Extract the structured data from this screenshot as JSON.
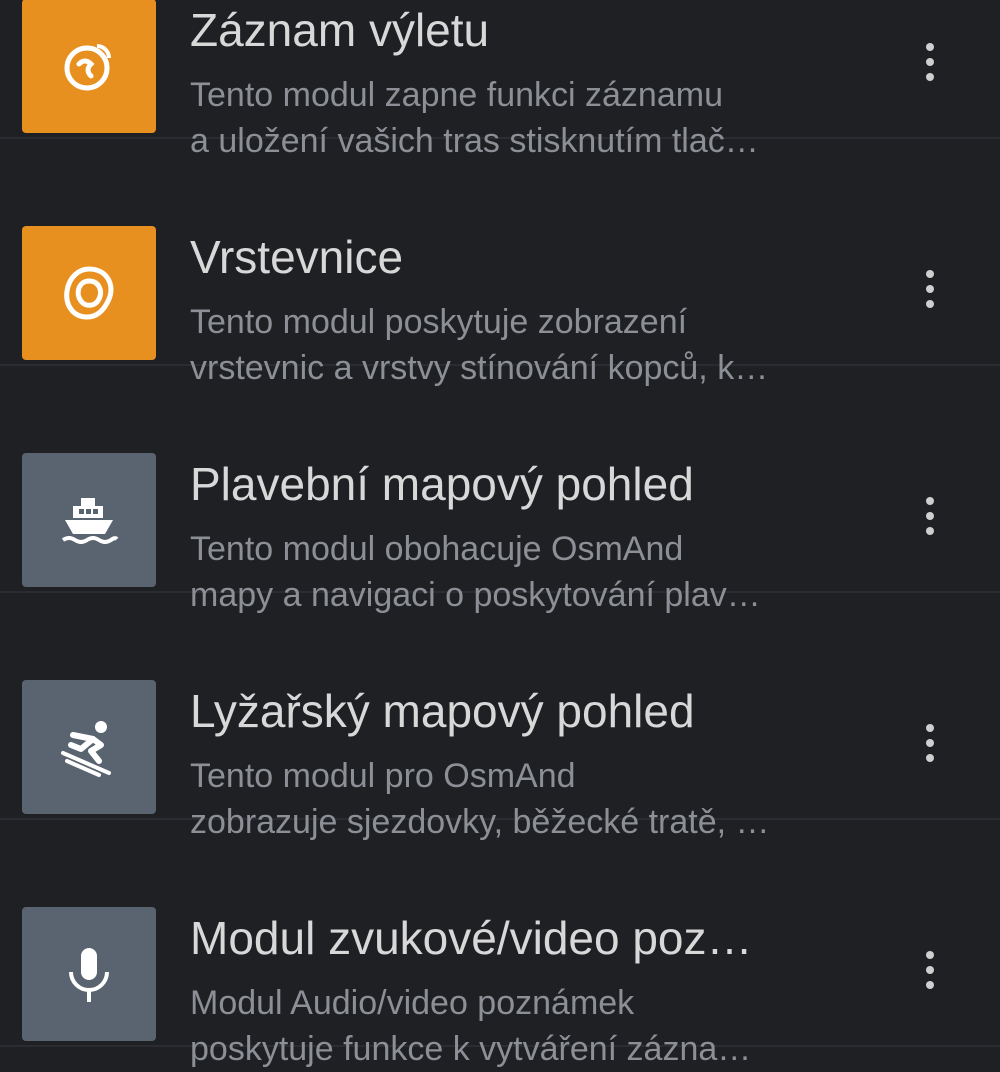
{
  "plugins": [
    {
      "title": "Záznam výletu",
      "desc_line1": "Tento modul zapne funkci záznamu",
      "desc_line2": "a uložení vašich tras stisknutím tlač…",
      "icon": "trip-recording-icon",
      "enabled": true
    },
    {
      "title": "Vrstevnice",
      "desc_line1": "Tento modul poskytuje zobrazení",
      "desc_line2": "vrstevnic a vrstvy stínování kopců, k…",
      "icon": "contour-lines-icon",
      "enabled": true
    },
    {
      "title": "Plavební mapový pohled",
      "desc_line1": "Tento modul obohacuje OsmAnd",
      "desc_line2": "mapy a navigaci o poskytování plav…",
      "icon": "ship-icon",
      "enabled": false
    },
    {
      "title": "Lyžařský mapový pohled",
      "desc_line1": "Tento modul pro OsmAnd",
      "desc_line2": "zobrazuje sjezdovky, běžecké tratě, …",
      "icon": "skier-icon",
      "enabled": false
    },
    {
      "title": "Modul zvukové/video poz…",
      "desc_line1": "Modul Audio/video poznámek",
      "desc_line2": "poskytuje funkce k vytváření zázna…",
      "icon": "microphone-icon",
      "enabled": false
    }
  ],
  "colors": {
    "active_tile": "#e8901f",
    "inactive_tile": "#5a6470",
    "background": "#1f2024"
  }
}
